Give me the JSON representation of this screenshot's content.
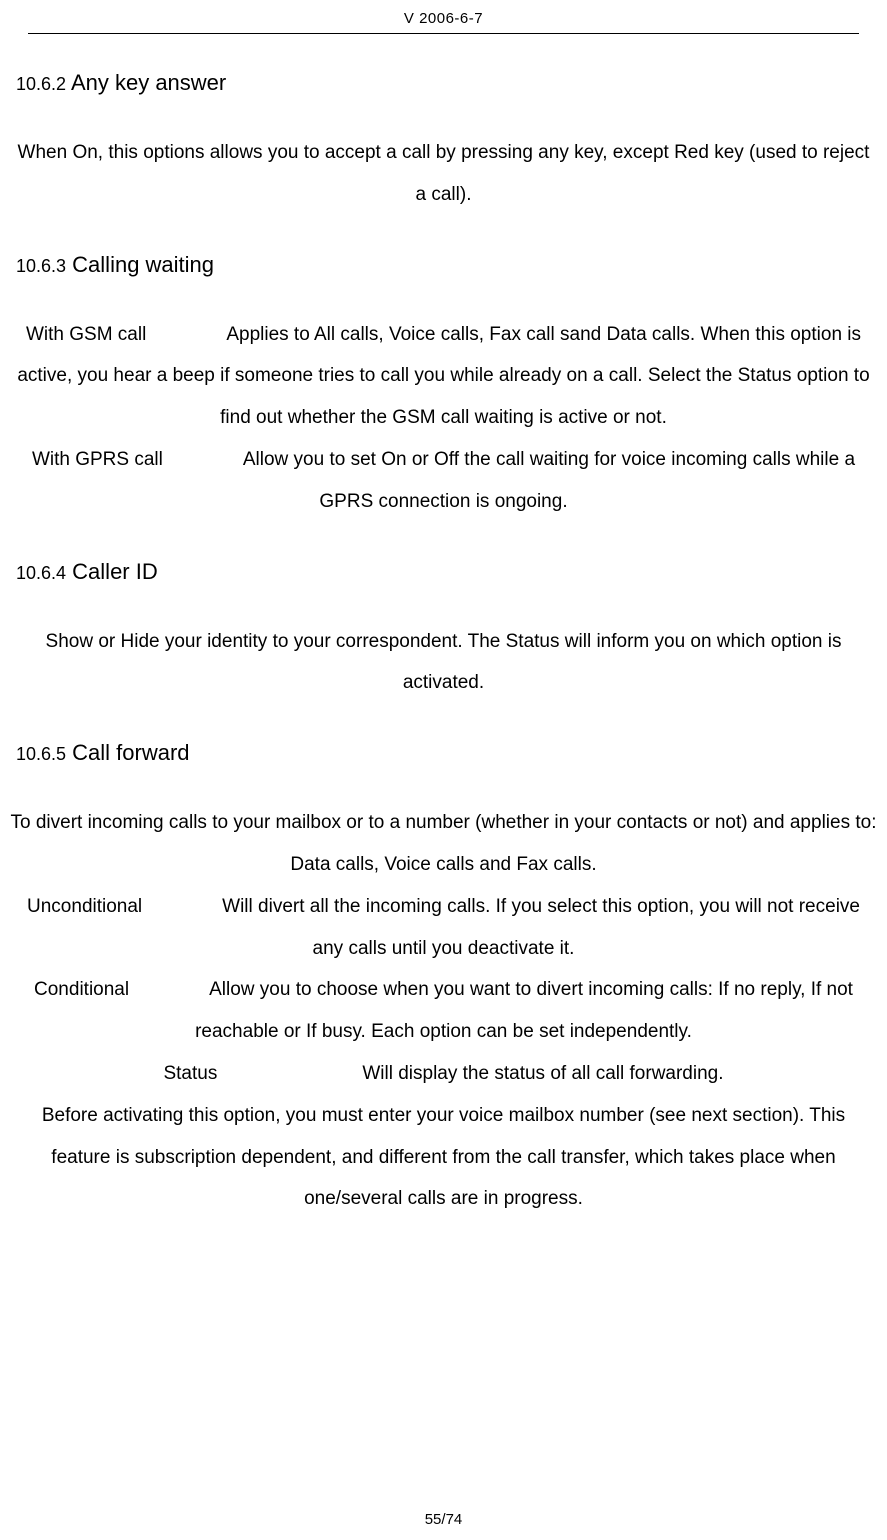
{
  "header": {
    "version": "V 2006-6-7"
  },
  "sections": {
    "anyKeyAnswer": {
      "number": "10.6.2",
      "title": "Any key answer",
      "body": "When On, this options allows you to accept a call by pressing any key, except Red key (used to reject a call)."
    },
    "callingWaiting": {
      "number": "10.6.3",
      "title": "Calling waiting",
      "gsmLabel": "With GSM call",
      "gsmText": "Applies to All calls, Voice calls, Fax call sand Data calls. When this option is active, you hear a beep if someone tries to call you while already on a call. Select the Status option to find out whether the GSM call waiting is active or not.",
      "gprsLabel": "With GPRS call",
      "gprsText": "Allow you to set On or Off the call waiting for voice incoming calls while a GPRS connection is ongoing."
    },
    "callerId": {
      "number": "10.6.4",
      "title": "Caller ID",
      "body": "Show or Hide your identity to your correspondent. The Status will inform you on which option is activated."
    },
    "callForward": {
      "number": "10.6.5",
      "title": "Call forward",
      "intro": "To divert incoming calls to your mailbox or to a number (whether in your contacts or not) and applies to: Data calls, Voice calls and Fax calls.",
      "unconditionalLabel": "Unconditional",
      "unconditionalText": "Will divert all the incoming calls. If you select this option, you will not receive any calls until you deactivate it.",
      "conditionalLabel": "Conditional",
      "conditionalText": "Allow you to choose when you want to divert incoming calls: If no reply, If not reachable or If busy. Each option can be set independently.",
      "statusLabel": "Status",
      "statusText": "Will display the status of all call forwarding.",
      "note": "Before activating this option, you must enter your voice mailbox number (see next section). This feature is subscription dependent, and different from the call transfer, which takes place when one/several calls are in progress."
    }
  },
  "footer": {
    "pageNumber": "55/74"
  }
}
